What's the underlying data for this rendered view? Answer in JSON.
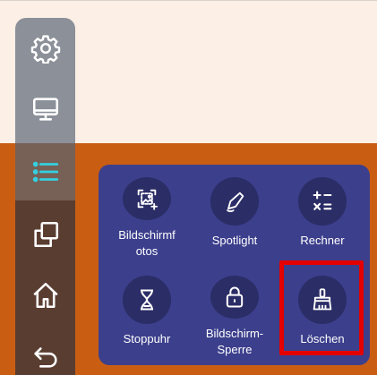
{
  "colors": {
    "background_top": "#fcefe5",
    "background_bottom": "#c95e13",
    "sidebar_top": "#8b9099",
    "sidebar_bottom": "#5a3d31",
    "panel": "#3c3f8c",
    "tile_circle": "#2b2d66",
    "active_icon": "#33d0e0",
    "highlight": "#e50000"
  },
  "sidebar": {
    "items": [
      {
        "name": "settings",
        "icon": "gear-icon"
      },
      {
        "name": "desktop",
        "icon": "monitor-icon"
      },
      {
        "name": "menu",
        "icon": "list-icon",
        "active": true
      },
      {
        "name": "windows",
        "icon": "multi-window-icon"
      },
      {
        "name": "home",
        "icon": "home-icon"
      },
      {
        "name": "back",
        "icon": "back-arrow-icon"
      }
    ]
  },
  "panel": {
    "tiles": [
      {
        "label": "Bildschirmf\notos",
        "icon": "screenshot-icon"
      },
      {
        "label": "Spotlight",
        "icon": "spotlight-icon"
      },
      {
        "label": "Rechner",
        "icon": "calculator-icon"
      },
      {
        "label": "Stoppuhr",
        "icon": "hourglass-icon"
      },
      {
        "label": "Bildschirm-\nSperre",
        "icon": "lock-icon"
      },
      {
        "label": "Löschen",
        "icon": "broom-icon"
      }
    ]
  }
}
